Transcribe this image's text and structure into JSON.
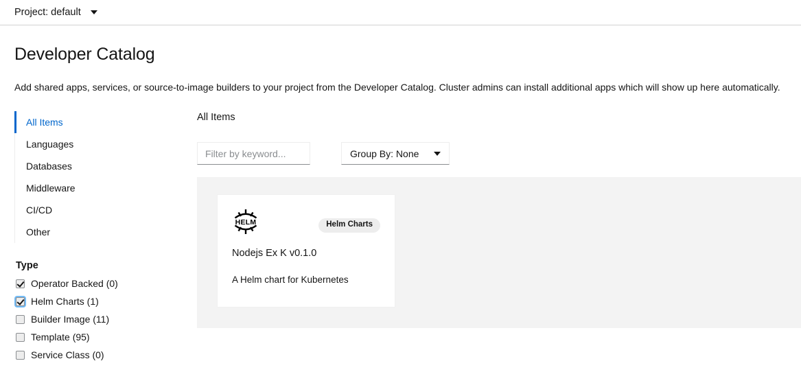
{
  "project_bar": {
    "label": "Project: default",
    "caret_icon": "chevron-down-icon"
  },
  "header": {
    "title": "Developer Catalog",
    "description": "Add shared apps, services, or source-to-image builders to your project from the Developer Catalog. Cluster admins can install additional apps which will show up here automatically."
  },
  "sidebar": {
    "categories": [
      {
        "label": "All Items",
        "active": true
      },
      {
        "label": "Languages",
        "active": false
      },
      {
        "label": "Databases",
        "active": false
      },
      {
        "label": "Middleware",
        "active": false
      },
      {
        "label": "CI/CD",
        "active": false
      },
      {
        "label": "Other",
        "active": false
      }
    ],
    "filter_group": {
      "title": "Type",
      "items": [
        {
          "label": "Operator Backed (0)",
          "checked": true,
          "focused": false
        },
        {
          "label": "Helm Charts (1)",
          "checked": true,
          "focused": true
        },
        {
          "label": "Builder Image (11)",
          "checked": false,
          "focused": false
        },
        {
          "label": "Template (95)",
          "checked": false,
          "focused": false
        },
        {
          "label": "Service Class (0)",
          "checked": false,
          "focused": false
        }
      ]
    }
  },
  "main": {
    "heading": "All Items",
    "search": {
      "placeholder": "Filter by keyword...",
      "value": ""
    },
    "group_by": {
      "label": "Group By: None",
      "caret_icon": "chevron-down-icon"
    },
    "tiles": [
      {
        "logo_icon": "helm-logo-icon",
        "logo_text": "HELM",
        "badge": "Helm Charts",
        "title": "Nodejs Ex K v0.1.0",
        "description": "A Helm chart for Kubernetes"
      }
    ]
  },
  "colors": {
    "accent": "#0066cc",
    "panel_bg": "#f3f3f3",
    "badge_bg": "#ededed",
    "text": "#151515",
    "placeholder": "#8a8d90",
    "border": "#d2d2d2"
  }
}
